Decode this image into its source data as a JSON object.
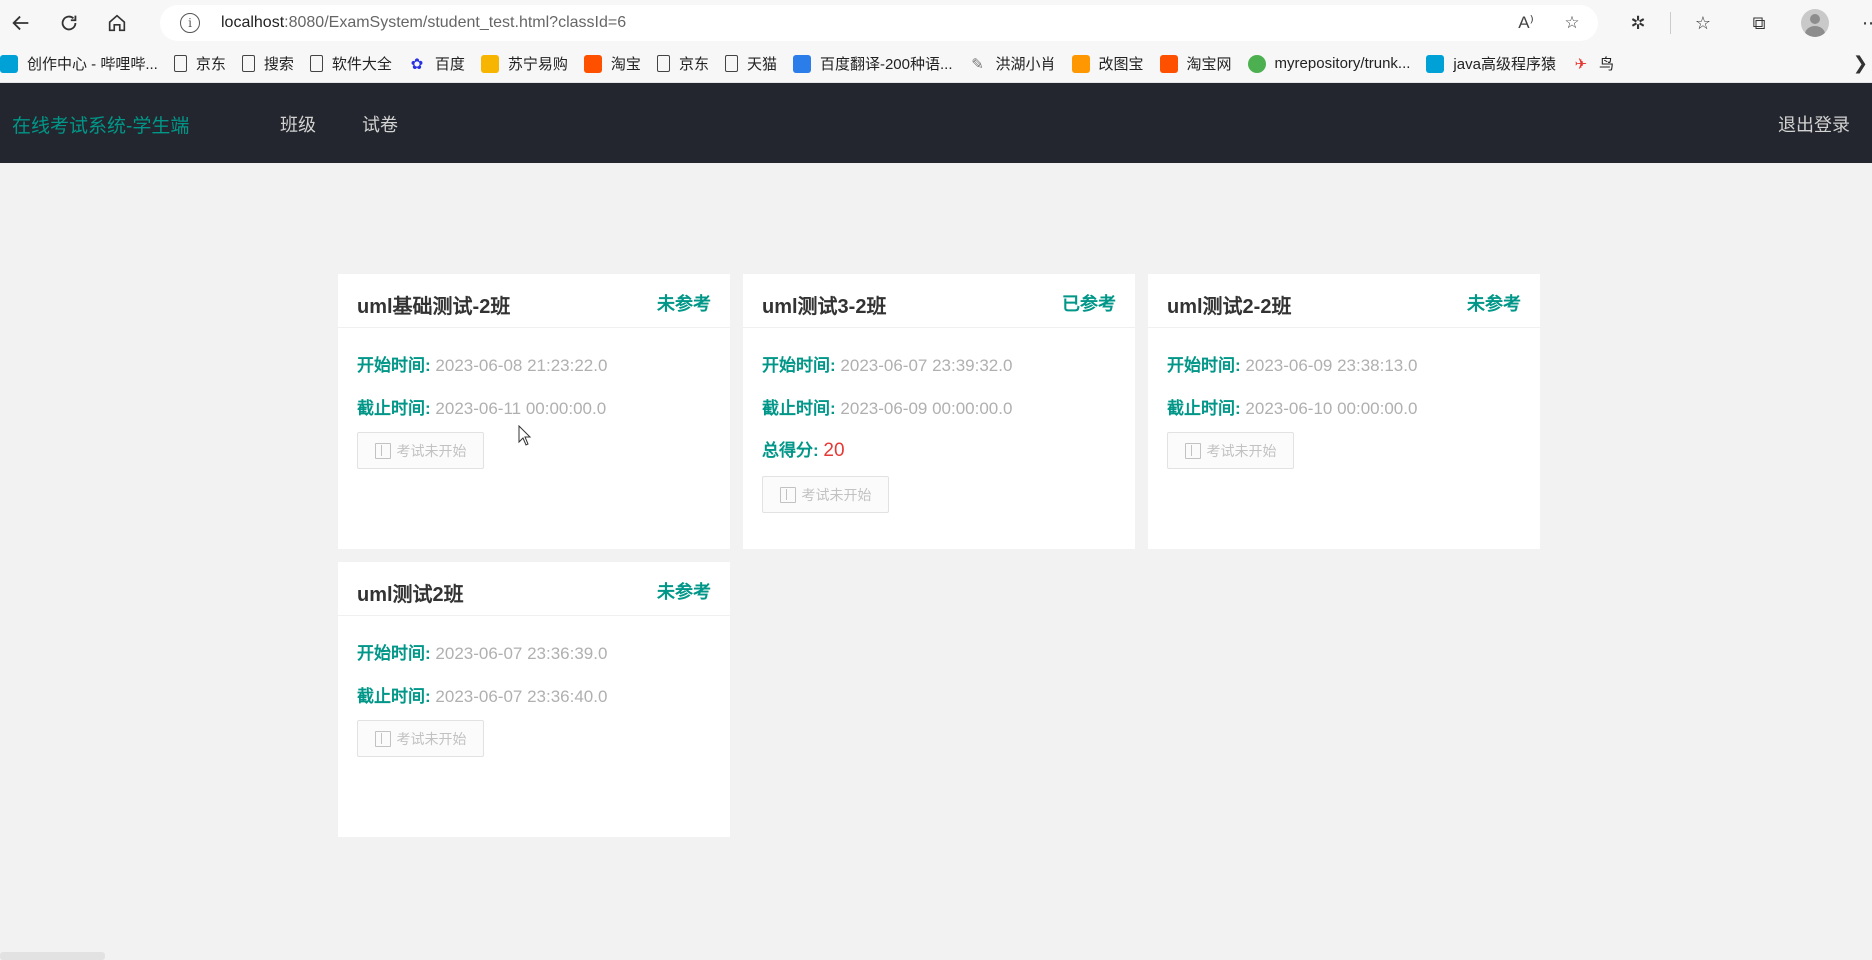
{
  "browser": {
    "url_host": "localhost",
    "url_path": ":8080/ExamSystem/student_test.html?classId=6"
  },
  "bookmarks": [
    {
      "label": "创作中心 - 哔哩哔...",
      "icon": "bilibili-icon",
      "color": "#00a1d6"
    },
    {
      "label": "京东",
      "icon": "page-icon"
    },
    {
      "label": "搜索",
      "icon": "page-icon"
    },
    {
      "label": "软件大全",
      "icon": "page-icon"
    },
    {
      "label": "百度",
      "icon": "baidu-paw-icon",
      "color": "#2932e1"
    },
    {
      "label": "苏宁易购",
      "icon": "suning-icon",
      "color": "#f7b500"
    },
    {
      "label": "淘宝",
      "icon": "taobao-icon",
      "color": "#ff5000"
    },
    {
      "label": "京东",
      "icon": "page-icon"
    },
    {
      "label": "天猫",
      "icon": "page-icon"
    },
    {
      "label": "百度翻译-200种语...",
      "icon": "baidu-translate-icon",
      "color": "#2b7de9"
    },
    {
      "label": "洪湖小肖",
      "icon": "pen-icon",
      "color": "#777777"
    },
    {
      "label": "改图宝",
      "icon": "gaitubao-icon",
      "color": "#ff9800"
    },
    {
      "label": "淘宝网",
      "icon": "taobao-icon",
      "color": "#ff5000"
    },
    {
      "label": "myrepository/trunk...",
      "icon": "chrome-icon",
      "color": "#4caf50"
    },
    {
      "label": "java高级程序猿",
      "icon": "bilibili-icon",
      "color": "#00a1d6"
    },
    {
      "label": "鸟",
      "icon": "bird-icon",
      "color": "#e53935"
    }
  ],
  "app": {
    "logo": "在线考试系统-学生端",
    "menu": [
      "班级",
      "试卷"
    ],
    "logout": "退出登录"
  },
  "labels": {
    "start": "开始时间:",
    "end": "截止时间:",
    "score": "总得分:"
  },
  "exams": [
    {
      "title": "uml基础测试-2班",
      "status": "未参考",
      "start": "2023-06-08 21:23:22.0",
      "end": "2023-06-11 00:00:00.0",
      "button": "考试未开始"
    },
    {
      "title": "uml测试3-2班",
      "status": "已参考",
      "start": "2023-06-07 23:39:32.0",
      "end": "2023-06-09 00:00:00.0",
      "score": "20",
      "button": "考试未开始"
    },
    {
      "title": "uml测试2-2班",
      "status": "未参考",
      "start": "2023-06-09 23:38:13.0",
      "end": "2023-06-10 00:00:00.0",
      "button": "考试未开始"
    },
    {
      "title": "uml测试2班",
      "status": "未参考",
      "start": "2023-06-07 23:36:39.0",
      "end": "2023-06-07 23:36:40.0",
      "button": "考试未开始"
    }
  ],
  "colors": {
    "accent": "#009688",
    "navbar": "#23262e",
    "score": "#e53935"
  }
}
